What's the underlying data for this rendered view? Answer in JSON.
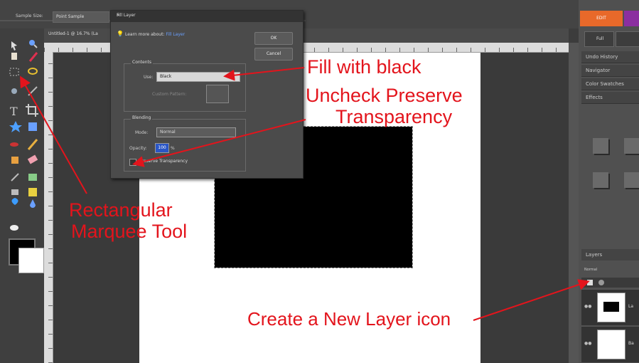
{
  "options_bar": {
    "sample_size_label": "Sample Size:",
    "sample_size_value": "Point Sample"
  },
  "document": {
    "title": "Untitled-1 @ 16.7% (La"
  },
  "right_panel": {
    "mode_tab": "EDIT",
    "full_button": "Full",
    "panels": [
      "Undo History",
      "Navigator",
      "Color Swatches",
      "Effects"
    ],
    "layers_title": "Layers",
    "blend_mode": "Normal",
    "layer_rows": [
      {
        "label": "La",
        "has_black": true
      },
      {
        "label": "Ba",
        "has_black": false
      }
    ]
  },
  "dialog": {
    "title": "Fill Layer",
    "info_text": "Learn more about:",
    "info_link": "Fill Layer",
    "ok": "OK",
    "cancel": "Cancel",
    "contents_legend": "Contents",
    "use_label": "Use:",
    "use_value": "Black",
    "custom_pattern_label": "Custom Pattern:",
    "blending_legend": "Blending",
    "mode_label": "Mode:",
    "mode_value": "Normal",
    "opacity_label": "Opacity:",
    "opacity_value": "100",
    "opacity_unit": "%",
    "preserve_label": "Preserve Transparency",
    "preserve_checked": false
  },
  "annotations": {
    "fill_black": "Fill with black",
    "uncheck_line1": "Uncheck Preserve",
    "uncheck_line2": "Transparency",
    "marquee_line1": "Rectangular",
    "marquee_line2": "Marquee Tool",
    "new_layer": "Create a New Layer icon",
    "color": "#e3141c"
  }
}
